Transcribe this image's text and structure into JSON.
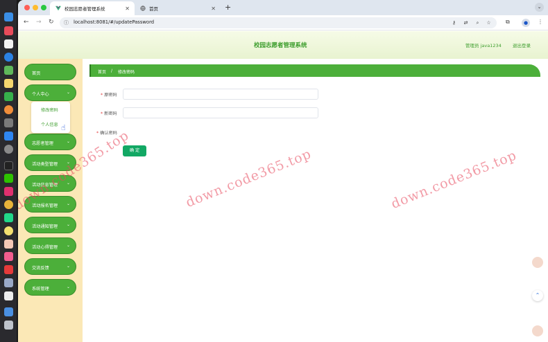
{
  "browser": {
    "tabs": [
      {
        "title": "校园志愿者管理系统",
        "active": true
      },
      {
        "title": "首页",
        "active": false
      }
    ],
    "url": "localhost:8081/#/updatePassword"
  },
  "app": {
    "title": "校园志愿者管理系统",
    "admin_label": "管理员 java1234",
    "logout_label": "退出登录"
  },
  "sidebar": {
    "items": [
      {
        "label": "首页",
        "has_submenu": false
      },
      {
        "label": "个人中心",
        "has_submenu": true
      },
      {
        "label": "志愿者管理",
        "has_submenu": true
      },
      {
        "label": "活动类型管理",
        "has_submenu": true
      },
      {
        "label": "活动信息管理",
        "has_submenu": true
      },
      {
        "label": "活动报名管理",
        "has_submenu": true
      },
      {
        "label": "活动通知管理",
        "has_submenu": true
      },
      {
        "label": "活动心得管理",
        "has_submenu": true
      },
      {
        "label": "交流反馈",
        "has_submenu": true
      },
      {
        "label": "系统管理",
        "has_submenu": true
      }
    ],
    "submenu": [
      "修改密码",
      "个人信息"
    ]
  },
  "breadcrumb": {
    "home": "首页",
    "separator": "/",
    "current": "修改密码"
  },
  "form": {
    "fields": [
      {
        "label": "原密码",
        "value": ""
      },
      {
        "label": "新密码",
        "value": ""
      },
      {
        "label": "确认密码",
        "value": ""
      }
    ],
    "submit_label": "确 定"
  },
  "watermark": "down.code365.top",
  "colors": {
    "primary_green": "#4caf3a",
    "header_bg": "#eef6dc",
    "sidebar_bg": "#fbe8b6",
    "submit_green": "#12a864",
    "watermark": "#e8485c"
  }
}
